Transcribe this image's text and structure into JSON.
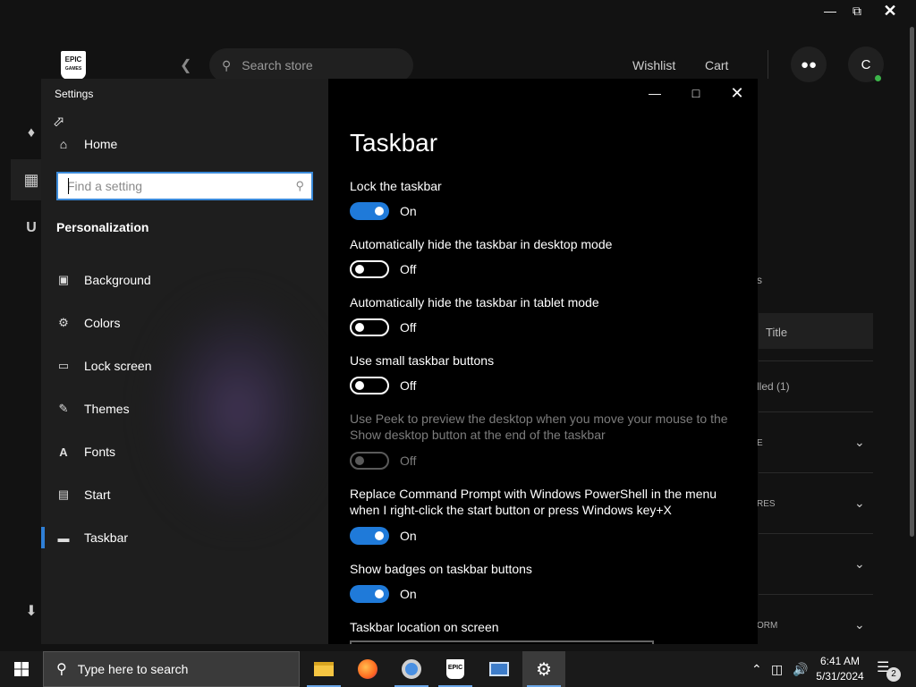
{
  "epic": {
    "search_placeholder": "Search store",
    "wishlist": "Wishlist",
    "cart": "Cart",
    "avatar_letter": "C",
    "logo_text": "EPIC",
    "logo_subtext": "GAMES",
    "panel_title": "Title",
    "fragment_installed": "lled (1)",
    "fragment_s": "s",
    "fragment_e": "E",
    "fragment_res": "RES",
    "fragment_form": "ORM"
  },
  "settings": {
    "app_title": "Settings",
    "home": "Home",
    "search_placeholder": "Find a setting",
    "section": "Personalization",
    "nav": [
      {
        "label": "Background",
        "icon": "image-icon"
      },
      {
        "label": "Colors",
        "icon": "palette-icon"
      },
      {
        "label": "Lock screen",
        "icon": "lock-screen-icon"
      },
      {
        "label": "Themes",
        "icon": "themes-icon"
      },
      {
        "label": "Fonts",
        "icon": "fonts-icon"
      },
      {
        "label": "Start",
        "icon": "start-icon"
      },
      {
        "label": "Taskbar",
        "icon": "taskbar-icon",
        "active": true
      }
    ],
    "page_title": "Taskbar",
    "options": [
      {
        "label": "Lock the taskbar",
        "state": "On"
      },
      {
        "label": "Automatically hide the taskbar in desktop mode",
        "state": "Off"
      },
      {
        "label": "Automatically hide the taskbar in tablet mode",
        "state": "Off"
      },
      {
        "label": "Use small taskbar buttons",
        "state": "Off"
      },
      {
        "label": "Use Peek to preview the desktop when you move your mouse to the Show desktop button at the end of the taskbar",
        "state": "Off",
        "disabled": true
      },
      {
        "label": "Replace Command Prompt with Windows PowerShell in the menu when I right-click the start button or press Windows key+X",
        "state": "On"
      },
      {
        "label": "Show badges on taskbar buttons",
        "state": "On"
      }
    ],
    "location_label": "Taskbar location on screen"
  },
  "taskbar": {
    "search_text": "Type here to search",
    "time": "6:41 AM",
    "date": "5/31/2024",
    "notification_count": "2",
    "epic_app_text": "EPIC"
  },
  "colors": {
    "accent": "#1f7ad9",
    "search_border": "#3b8ad9"
  }
}
